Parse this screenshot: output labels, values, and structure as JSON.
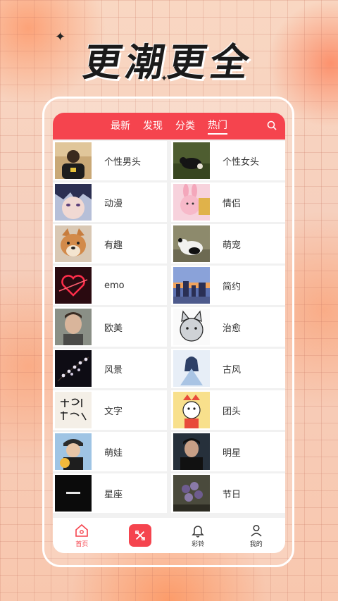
{
  "hero": {
    "title": "更潮更全"
  },
  "colors": {
    "accent": "#f5444e"
  },
  "tabs": [
    {
      "label": "最新",
      "active": false
    },
    {
      "label": "发现",
      "active": false
    },
    {
      "label": "分类",
      "active": false
    },
    {
      "label": "热门",
      "active": true
    }
  ],
  "categories": [
    {
      "label": "个性男头",
      "icon": "man-portrait-thumbnail"
    },
    {
      "label": "个性女头",
      "icon": "dog-on-grass-thumbnail"
    },
    {
      "label": "动漫",
      "icon": "anime-boy-thumbnail"
    },
    {
      "label": "情侣",
      "icon": "bunny-cartoon-thumbnail"
    },
    {
      "label": "有趣",
      "icon": "shiba-dog-thumbnail"
    },
    {
      "label": "萌宠",
      "icon": "panda-thumbnail"
    },
    {
      "label": "emo",
      "icon": "neon-heart-thumbnail"
    },
    {
      "label": "简约",
      "icon": "city-sunset-thumbnail"
    },
    {
      "label": "欧美",
      "icon": "western-man-thumbnail"
    },
    {
      "label": "治愈",
      "icon": "cartoon-cat-thumbnail"
    },
    {
      "label": "风景",
      "icon": "flower-branch-thumbnail"
    },
    {
      "label": "古风",
      "icon": "ancient-style-thumbnail"
    },
    {
      "label": "文字",
      "icon": "handwriting-text-thumbnail"
    },
    {
      "label": "团头",
      "icon": "cartoon-group-thumbnail"
    },
    {
      "label": "萌娃",
      "icon": "kid-with-ball-thumbnail"
    },
    {
      "label": "明星",
      "icon": "celebrity-thumbnail"
    },
    {
      "label": "星座",
      "icon": "dark-text-thumbnail"
    },
    {
      "label": "节日",
      "icon": "bouquet-thumbnail"
    }
  ],
  "bottom_nav": [
    {
      "label": "首页",
      "icon": "home-icon",
      "active": true
    },
    {
      "label": "",
      "icon": "tools-icon",
      "active": false
    },
    {
      "label": "彩铃",
      "icon": "bell-icon",
      "active": false
    },
    {
      "label": "我的",
      "icon": "user-icon",
      "active": false
    }
  ]
}
